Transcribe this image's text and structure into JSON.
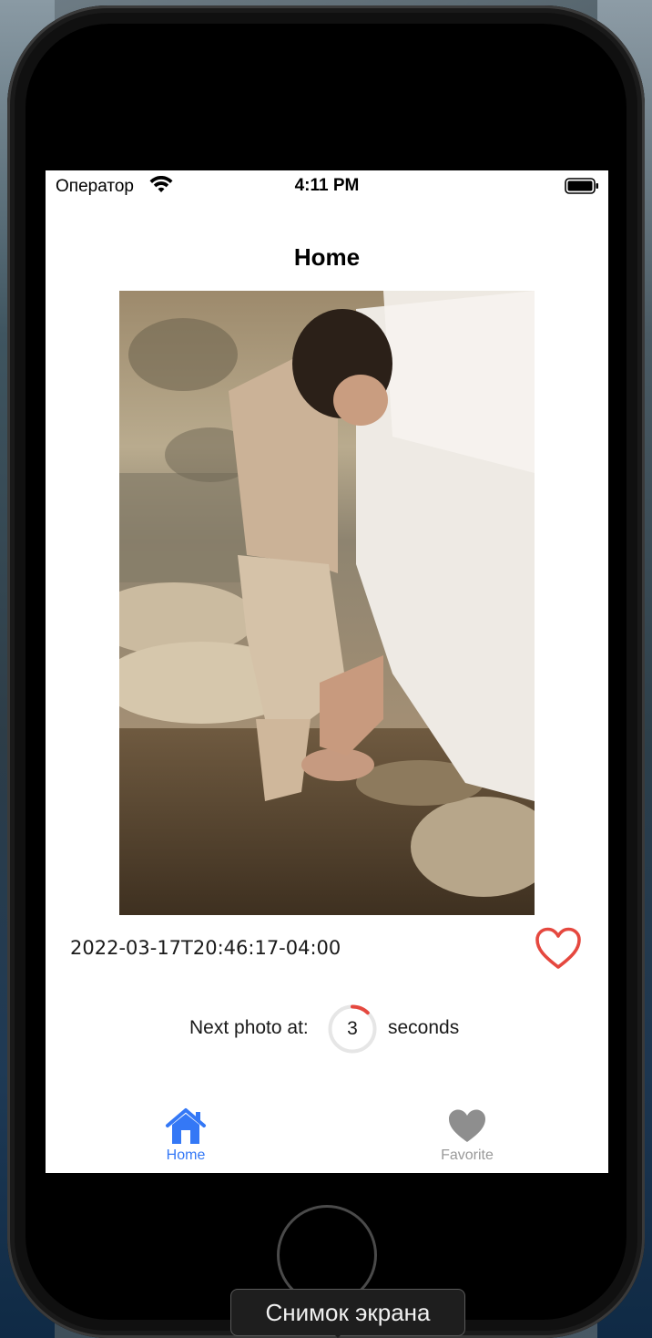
{
  "status_bar": {
    "carrier": "Оператор",
    "time": "4:11 PM"
  },
  "nav": {
    "title": "Home"
  },
  "photo": {
    "description_icon": "photo-image"
  },
  "photo_info": {
    "timestamp": "2022-03-17T20:46:17-04:00",
    "favorite_icon": "heart-outline-icon",
    "favorite_color": "#e5483f"
  },
  "timer": {
    "label": "Next photo at:",
    "value": "3",
    "unit": "seconds",
    "progress": 0.12,
    "ring_color": "#e5483f",
    "track_color": "#e6e6e6"
  },
  "tabs": [
    {
      "label": "Home",
      "icon": "house-icon",
      "active": true,
      "color": "#3478f6"
    },
    {
      "label": "Favorite",
      "icon": "heart-filled-icon",
      "active": false,
      "color": "#8e8e8e"
    }
  ],
  "tooltip": {
    "text": "Снимок экрана"
  }
}
